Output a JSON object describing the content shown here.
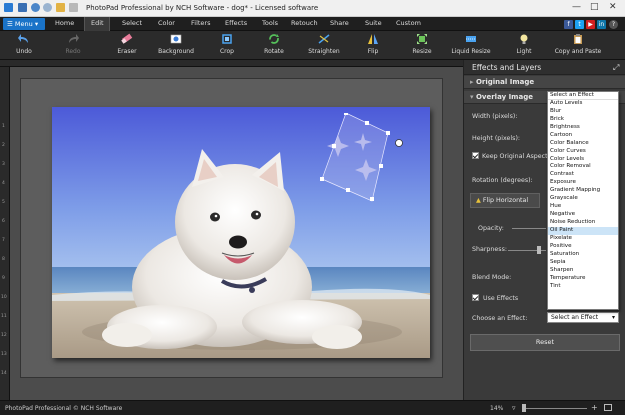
{
  "window": {
    "title": "PhotoPad Professional by NCH Software - dog* - Licensed software",
    "controls": [
      "minimize-icon",
      "maximize-icon",
      "close-icon"
    ]
  },
  "menubar": {
    "menu_label": "Menu",
    "tabs": [
      "Home",
      "Edit",
      "Select",
      "Color",
      "Filters",
      "Effects",
      "Tools",
      "Retouch",
      "Share",
      "Suite",
      "Custom"
    ],
    "active_tab": "Edit",
    "social_icons": [
      "facebook-icon",
      "twitter-icon",
      "youtube-icon",
      "linkedin-icon",
      "help-icon"
    ]
  },
  "toolbar": {
    "undo": "Undo",
    "redo": "Redo",
    "eraser": "Eraser",
    "background": "Background",
    "crop": "Crop",
    "rotate": "Rotate",
    "straighten": "Straighten",
    "flip": "Flip",
    "resize": "Resize",
    "liquid_resize": "Liquid Resize",
    "light": "Light",
    "copy_paste": "Copy and Paste"
  },
  "rulers": {
    "left": [
      "1",
      "2",
      "3",
      "4",
      "5",
      "6",
      "7",
      "8",
      "9",
      "10",
      "11",
      "12",
      "13",
      "14"
    ]
  },
  "panel": {
    "title": "Effects and Layers",
    "original_image": "Original Image",
    "overlay_image": "Overlay Image",
    "width_label": "Width (pixels):",
    "height_label": "Height (pixels):",
    "keep_aspect": "Keep Original Aspect Rat",
    "rotation_label": "Rotation (degrees):",
    "flip_horizontal": "Flip Horizontal",
    "opacity_label": "Opacity:",
    "sharpness_label": "Sharpness:",
    "blend_label": "Blend Mode:",
    "use_effects": "Use Effects",
    "choose_effect_label": "Choose an Effect:",
    "choose_effect_value": "Select an Effect",
    "reset": "Reset"
  },
  "effect_options": [
    "Select an Effect",
    "Auto Levels",
    "Blur",
    "Brick",
    "Brightness",
    "Cartoon",
    "Color Balance",
    "Color Curves",
    "Color Levels",
    "Color Removal",
    "Contrast",
    "Exposure",
    "Gradient Mapping",
    "Grayscale",
    "Hue",
    "Negative",
    "Noise Reduction",
    "Oil Paint",
    "Pixelate",
    "Positive",
    "Saturation",
    "Sepia",
    "Sharpen",
    "Temperature",
    "Tint"
  ],
  "highlighted_option": "Oil Paint",
  "status": {
    "text": "PhotoPad Professional © NCH Software",
    "zoom": "14%"
  },
  "colors": {
    "accent": "#1a73c8",
    "sky_top": "#4f63d8",
    "sky_bottom": "#8fb0ea"
  }
}
